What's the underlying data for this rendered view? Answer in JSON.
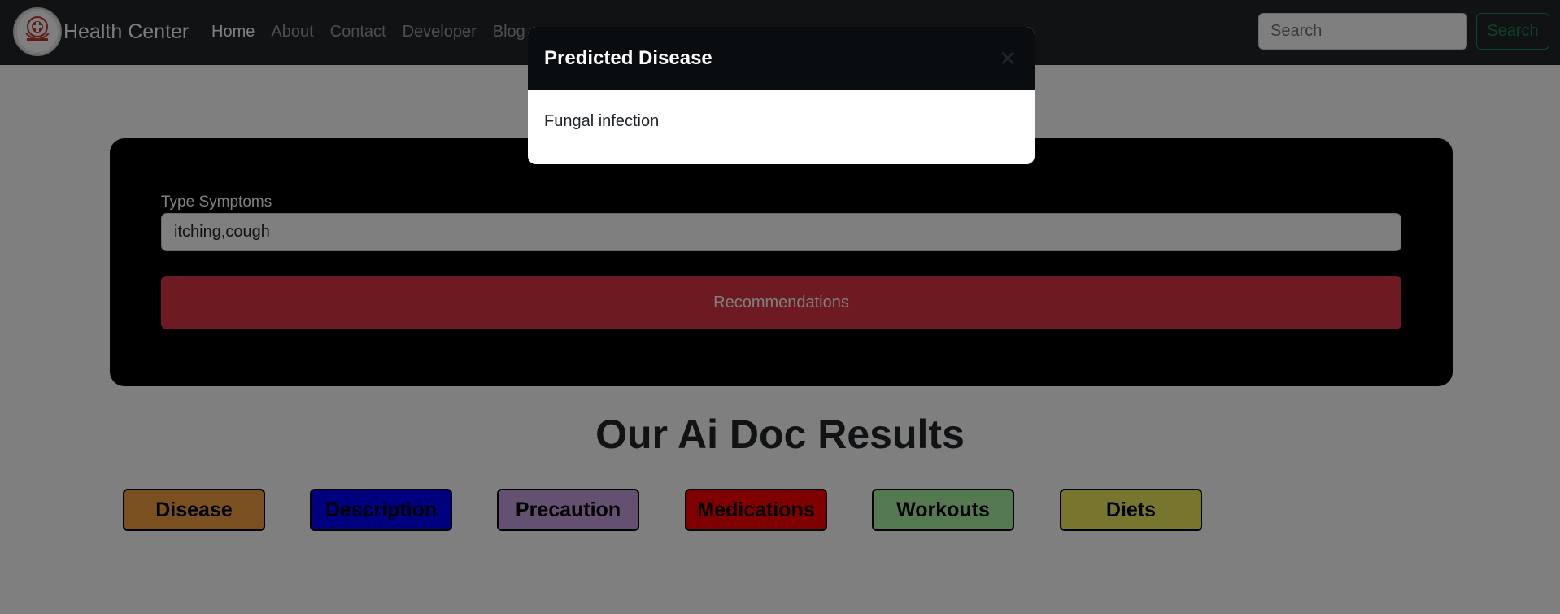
{
  "navbar": {
    "brand": "Health Center",
    "links": [
      "Home",
      "About",
      "Contact",
      "Developer",
      "Blog"
    ],
    "active_link": "Home",
    "search_placeholder": "Search",
    "search_button": "Search"
  },
  "form": {
    "label": "Type Symptoms",
    "symptoms_value": "itching,cough",
    "submit_button": "Recommendations"
  },
  "results": {
    "title": "Our Ai Doc Results",
    "buttons": [
      {
        "label": "Disease",
        "color": "#f5a142"
      },
      {
        "label": "Description",
        "color": "#0000ff"
      },
      {
        "label": "Precaution",
        "color": "#c9a0e0"
      },
      {
        "label": "Medications",
        "color": "#ff0000"
      },
      {
        "label": "Workouts",
        "color": "#a8f0a0"
      },
      {
        "label": "Diets",
        "color": "#f0ea5c"
      }
    ]
  },
  "modal": {
    "title": "Predicted Disease",
    "body": "Fungal infection",
    "close_icon": "close-icon"
  },
  "colors": {
    "navbar_bg": "#212529",
    "accent_danger": "#dc3545",
    "accent_success": "#198754"
  }
}
